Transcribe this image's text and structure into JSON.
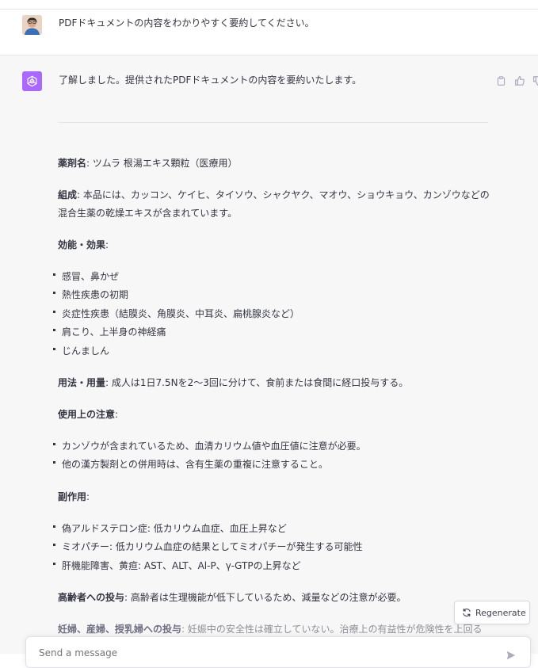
{
  "user_message": "PDFドキュメントの内容をわかりやすく要約してください。",
  "assistant": {
    "intro": "了解しました。提供されたPDFドキュメントの内容を要約いたします。",
    "drug_label": "薬剤名",
    "drug_value": ": ツムラ 根湯エキス顆粒（医療用）",
    "composition_label": "組成",
    "composition_value": ": 本品には、カッコン、ケイヒ、タイソウ、シャクヤク、マオウ、ショウキョウ、カンゾウなどの混合生薬の乾燥エキスが含まれています。",
    "efficacy_label": "効能・効果",
    "efficacy_items": [
      "感冒、鼻かぜ",
      "熱性疾患の初期",
      "炎症性疾患（結膜炎、角膜炎、中耳炎、扁桃腺炎など）",
      "肩こり、上半身の神経痛",
      "じんましん"
    ],
    "dosage_label": "用法・用量",
    "dosage_value": ": 成人は1日7.5Nを2〜3回に分けて、食前または食間に経口投与する。",
    "precautions_label": "使用上の注意",
    "precaution_items": [
      "カンゾウが含まれているため、血清カリウム値や血圧値に注意が必要。",
      "他の漢方製剤との併用時は、含有生薬の重複に注意すること。"
    ],
    "side_effects_label": "副作用",
    "side_effect_items": [
      "偽アルドステロン症: 低カリウム血症、血圧上昇など",
      "ミオパチー: 低カリウム血症の結果としてミオパチーが発生する可能性",
      "肝機能障害、黄疸: AST、ALT、Al-P、γ-GTPの上昇など"
    ],
    "elderly_label": "高齢者への投与",
    "elderly_value": ": 高齢者は生理機能が低下しているため、減量などの注意が必要。",
    "pregnancy_label": "妊婦、産婦、授乳婦への投与",
    "pregnancy_value": ": 妊娠中の安全性は確立していない。治療上の有益性が危険性を上回る"
  },
  "regenerate_label": "Regenerate",
  "input": {
    "placeholder": "Send a message"
  },
  "colors": {
    "gpt_avatar": "#ab68ff",
    "assistant_bg": "#f7f7f8"
  }
}
